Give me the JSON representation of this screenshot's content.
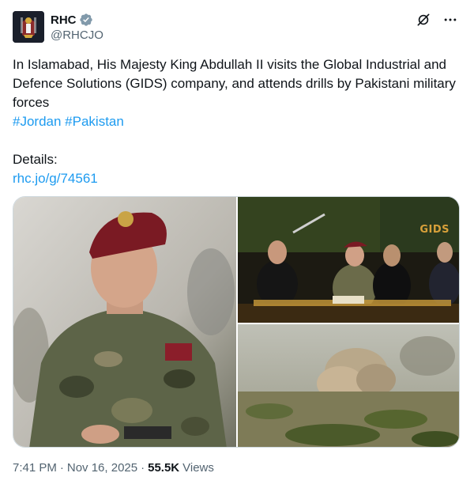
{
  "author": {
    "display_name": "RHC",
    "handle": "@RHCJO",
    "verified_icon": "verified-badge-icon"
  },
  "top_icons": [
    "grok-icon",
    "more-icon"
  ],
  "tweet": {
    "text": "In Islamabad, His Majesty King Abdullah II visits the Global Industrial and Defence Solutions (GIDS) company, and attends drills by Pakistani military forces",
    "hashtags": [
      "#Jordan",
      "#Pakistan"
    ],
    "details_label": "Details:",
    "link": "rhc.jo/g/74561"
  },
  "media": {
    "top_right_logo_text": "GIDS"
  },
  "footer": {
    "time": "7:41 PM",
    "date": "Nov 16, 2025",
    "separator": "·",
    "views_count": "55.5K",
    "views_label": "Views"
  },
  "colors": {
    "link": "#1d9bf0",
    "text": "#0f1419",
    "muted": "#536471",
    "border": "#cfd9de"
  }
}
